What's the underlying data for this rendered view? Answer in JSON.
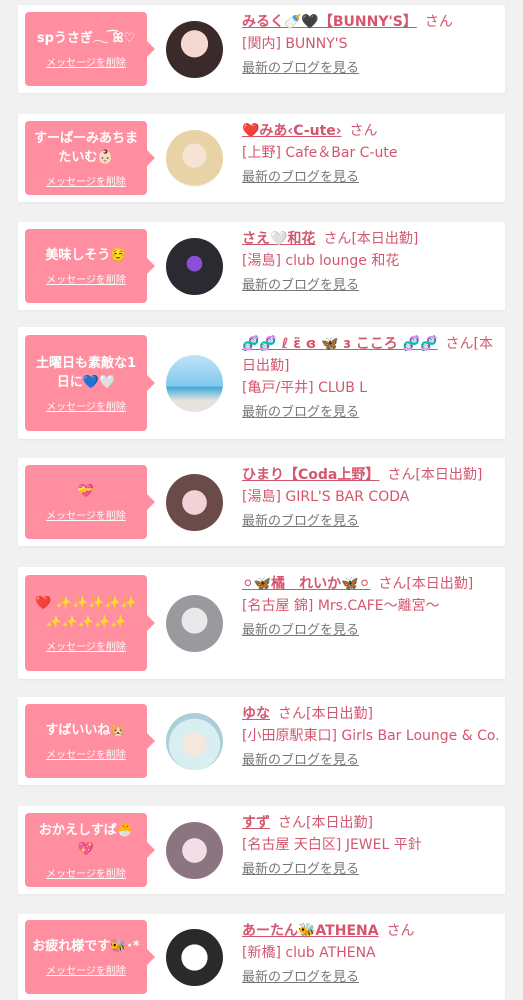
{
  "messages": [
    {
      "message": "spうさぎ𓂃 ͡ꕤ♡",
      "delete_label": "メッセージを削除",
      "name": "みるく🍼🖤【BUNNY'S】",
      "san": "さん",
      "status": "",
      "shop": "[関内] BUNNY'S",
      "blog_label": "最新のブログを見る",
      "avatar_icon": "profile-photo-icon"
    },
    {
      "message": "すーぱーみあちまたいむ👶🏻",
      "delete_label": "メッセージを削除",
      "name": "❤️みあ‹C-ute›",
      "san": "さん",
      "status": "",
      "shop": "[上野] Cafe＆Bar C-ute",
      "blog_label": "最新のブログを見る",
      "avatar_icon": "profile-photo-icon"
    },
    {
      "message": "美味しそう☺️",
      "delete_label": "メッセージを削除",
      "name": "さえ🤍和花",
      "san": "さん",
      "status": "[本日出勤]",
      "shop": "[湯島] club lounge 和花",
      "blog_label": "最新のブログを見る",
      "avatar_icon": "profile-photo-icon"
    },
    {
      "message": "土曜日も素敵な1日に💙🤍",
      "delete_label": "メッセージを削除",
      "name": "🧬🧬 ℓ ɛ̃ ɞ 🦋 ɜ こころ 🧬🧬",
      "san": "さん",
      "status": "[本日出勤]",
      "shop": "[亀戸/平井] CLUB L",
      "blog_label": "最新のブログを見る",
      "avatar_icon": "profile-photo-icon"
    },
    {
      "message": "💝",
      "delete_label": "メッセージを削除",
      "name": "ひまり【Coda上野】",
      "san": "さん",
      "status": "[本日出勤]",
      "shop": "[湯島] GIRL'S BAR CODA",
      "blog_label": "最新のブログを見る",
      "avatar_icon": "profile-photo-icon"
    },
    {
      "message": "❤️ ✨✨✨✨✨✨✨✨✨✨",
      "delete_label": "メッセージを削除",
      "name": "⚪︎🦋橘　れいか🦋⚪︎",
      "san": "さん",
      "status": "[本日出勤]",
      "shop": "[名古屋 錦] Mrs.CAFE〜離宮〜",
      "blog_label": "最新のブログを見る",
      "avatar_icon": "profile-photo-icon"
    },
    {
      "message": "すばいいね🐹",
      "delete_label": "メッセージを削除",
      "name": "ゆな",
      "san": "さん",
      "status": "[本日出勤]",
      "shop": "[小田原駅東口] Girls Bar Lounge & Co.",
      "blog_label": "最新のブログを見る",
      "avatar_icon": "profile-photo-icon"
    },
    {
      "message": "おかえしすば🐣💖",
      "delete_label": "メッセージを削除",
      "name": "すず",
      "san": "さん",
      "status": "[本日出勤]",
      "shop": "[名古屋 天白区] JEWEL 平針",
      "blog_label": "最新のブログを見る",
      "avatar_icon": "profile-photo-icon"
    },
    {
      "message": "お疲れ様です🐝･*",
      "delete_label": "メッセージを削除",
      "name": "あーたん🐝ATHENA",
      "san": "さん",
      "status": "",
      "shop": "[新橋] club ATHENA",
      "blog_label": "最新のブログを見る",
      "avatar_icon": "profile-photo-icon"
    }
  ],
  "colors": {
    "bubble": "#ff8fa0",
    "accent_text": "#d4566e",
    "link_gray": "#777777",
    "background": "#f1f1f1"
  }
}
